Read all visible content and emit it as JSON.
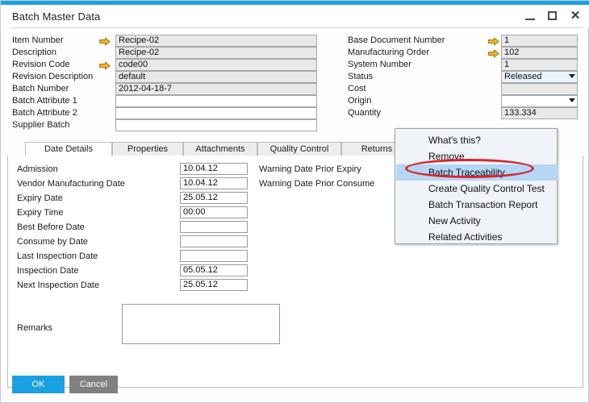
{
  "window": {
    "title": "Batch Master Data",
    "accent_color": "#1ba1e2",
    "minimize_label": "",
    "maximize_label": "",
    "close_label": "✕"
  },
  "form_left": [
    {
      "label": "Item Number",
      "value": "Recipe-02",
      "arrow": true,
      "style": "readonly"
    },
    {
      "label": "Description",
      "value": "Recipe-02",
      "arrow": false,
      "style": "readonly"
    },
    {
      "label": "Revision Code",
      "value": "code00",
      "arrow": true,
      "style": "readonly"
    },
    {
      "label": "Revision Description",
      "value": "default",
      "arrow": false,
      "style": "readonly"
    },
    {
      "label": "Batch Number",
      "value": "2012-04-18-7",
      "arrow": false,
      "style": "readonly"
    },
    {
      "label": "Batch Attribute 1",
      "value": "",
      "arrow": false,
      "style": "editable"
    },
    {
      "label": "Batch Attribute 2",
      "value": "",
      "arrow": false,
      "style": "editable"
    },
    {
      "label": "Supplier Batch",
      "value": "",
      "arrow": false,
      "style": "editable"
    }
  ],
  "form_right": [
    {
      "label": "Base Document Number",
      "value": "1",
      "arrow": true,
      "style": "readonly",
      "dropdown": false
    },
    {
      "label": "Manufacturing Order",
      "value": "102",
      "arrow": true,
      "style": "readonly",
      "dropdown": false
    },
    {
      "label": "System Number",
      "value": "1",
      "arrow": false,
      "style": "readonly",
      "dropdown": false
    },
    {
      "label": "Status",
      "value": "Released",
      "arrow": false,
      "style": "highlight",
      "dropdown": true
    },
    {
      "label": "Cost",
      "value": "",
      "arrow": false,
      "style": "readonly",
      "dropdown": false
    },
    {
      "label": "Origin",
      "value": "",
      "arrow": false,
      "style": "editable",
      "dropdown": true
    },
    {
      "label": "Quantity",
      "value": "133.334",
      "arrow": false,
      "style": "readonly",
      "dropdown": false
    }
  ],
  "tabs": [
    {
      "label": "Date Details",
      "active": true
    },
    {
      "label": "Properties",
      "active": false
    },
    {
      "label": "Attachments",
      "active": false
    },
    {
      "label": "Quality Control",
      "active": false
    },
    {
      "label": "Returns",
      "active": false
    }
  ],
  "date_details": [
    {
      "label": "Admission",
      "value": "10.04.12"
    },
    {
      "label": "Vendor Manufacturing Date",
      "value": "10.04.12"
    },
    {
      "label": "Expiry Date",
      "value": "25.05.12"
    },
    {
      "label": "Expiry Time",
      "value": "00:00"
    },
    {
      "label": "Best Before Date",
      "value": ""
    },
    {
      "label": "Consume by Date",
      "value": ""
    },
    {
      "label": "Last Inspection Date",
      "value": ""
    },
    {
      "label": "Inspection Date",
      "value": "05.05.12"
    },
    {
      "label": "Next Inspection Date",
      "value": "25.05.12"
    }
  ],
  "warnings": [
    {
      "label": "Warning Date Prior Expiry"
    },
    {
      "label": "Warning Date Prior Consume"
    }
  ],
  "remarks": {
    "label": "Remarks",
    "value": ""
  },
  "footer": {
    "ok_label": "OK",
    "cancel_label": "Cancel"
  },
  "context_menu": {
    "items": [
      {
        "label": "What's this?",
        "selected": false,
        "accel": ""
      },
      {
        "label": "Remove",
        "selected": false,
        "accel": "e"
      },
      {
        "label": "Batch Traceability",
        "selected": true,
        "accel": ""
      },
      {
        "label": "Create Quality Control Test",
        "selected": false,
        "accel": ""
      },
      {
        "label": "Batch Transaction Report",
        "selected": false,
        "accel": ""
      },
      {
        "label": "New Activity",
        "selected": false,
        "accel": ""
      },
      {
        "label": "Related Activities",
        "selected": false,
        "accel": ""
      }
    ],
    "highlight_color": "#b5d6f4",
    "annotation_color": "#d8252b"
  }
}
